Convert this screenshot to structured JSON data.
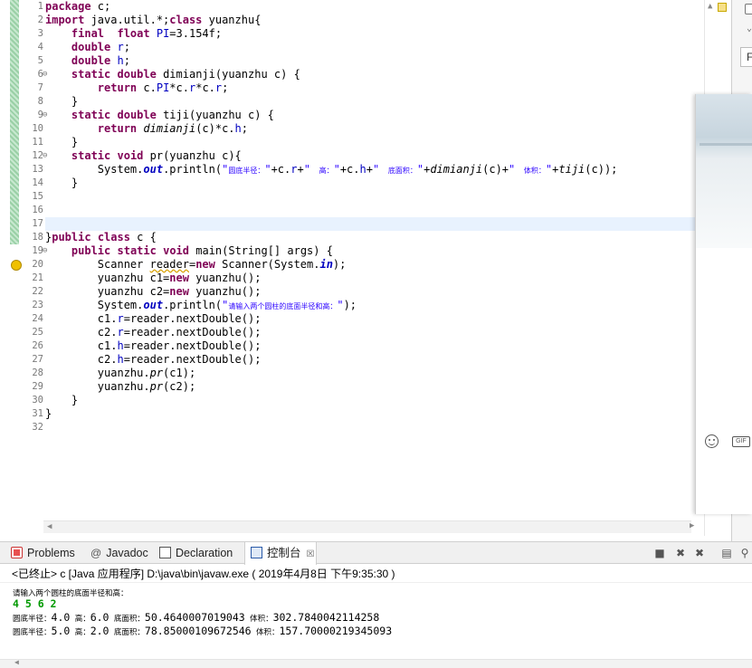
{
  "editor": {
    "line_numbers": [
      "1",
      "2",
      "3",
      "4",
      "5",
      "6",
      "7",
      "8",
      "9",
      "10",
      "11",
      "12",
      "13",
      "14",
      "15",
      "16",
      "17",
      "18",
      "19",
      "20",
      "21",
      "22",
      "23",
      "24",
      "25",
      "26",
      "27",
      "28",
      "29",
      "30",
      "31",
      "32"
    ],
    "folds": {
      "line6": "⊖",
      "line9": "⊖",
      "line12": "⊖",
      "line19": "⊖"
    },
    "code": {
      "l1_kw": "package",
      "l1_rest": " c;",
      "l2_kw1": "import",
      "l2_mid": " java.util.*;",
      "l2_kw2": "class",
      "l2_rest": " yuanzhu{",
      "l3_kw": "final",
      "l3_kw2": "float",
      "l3_fld": "PI",
      "l3_rest": "=3.154f;",
      "l4_kw": "double",
      "l4_fld": "r",
      "l4_rest": ";",
      "l5_kw": "double",
      "l5_fld": "h",
      "l5_rest": ";",
      "l6_kw1": "static",
      "l6_kw2": "double",
      "l6_rest": " dimianji(yuanzhu c) {",
      "l7_kw": "return",
      "l7_a": " c.",
      "l7_fld1": "PI",
      "l7_b": "*c.",
      "l7_fld2": "r",
      "l7_c": "*c.",
      "l7_fld3": "r",
      "l7_d": ";",
      "l8": "}",
      "l9_kw1": "static",
      "l9_kw2": "double",
      "l9_rest": " tiji(yuanzhu c) {",
      "l10_kw": "return",
      "l10_it": "dimianji",
      "l10_a": "(c)*c.",
      "l10_fld": "h",
      "l10_b": ";",
      "l11": "}",
      "l12_kw1": "static",
      "l12_kw2": "void",
      "l12_rest": " pr(yuanzhu c){",
      "l13_a": "System.",
      "l13_sf": "out",
      "l13_b": ".println(",
      "l13_s1q": "\"",
      "l13_s1m": "圆底半径：",
      "l13_s1e": "\"",
      "l13_c": "+c.",
      "l13_fld1": "r",
      "l13_d": "+",
      "l13_s2q": "\"",
      "l13_s2m": "  高：",
      "l13_s2e": "\"",
      "l13_e": "+c.",
      "l13_fld2": "h",
      "l13_f": "+",
      "l13_s3q": "\"",
      "l13_s3m": "  底面积：",
      "l13_s3e": "\"",
      "l13_g": "+",
      "l13_it1": "dimianji",
      "l13_h": "(c)+",
      "l13_s4q": "\"",
      "l13_s4m": "  体积：",
      "l13_s4e": "\"",
      "l13_i": "+",
      "l13_it2": "tiji",
      "l13_j": "(c));",
      "l14": "}",
      "l18_a": "}",
      "l18_kw1": "public",
      "l18_kw2": "class",
      "l18_rest": " c {",
      "l19_kw1": "public",
      "l19_kw2": "static",
      "l19_kw3": "void",
      "l19_rest": " main(String[] args) {",
      "l20_a": "Scanner ",
      "l20_sq": "reader",
      "l20_b": "=",
      "l20_kw": "new",
      "l20_c": " Scanner(System.",
      "l20_sf": "in",
      "l20_d": ");",
      "l21_a": "yuanzhu c1=",
      "l21_kw": "new",
      "l21_b": " yuanzhu();",
      "l22_a": "yuanzhu c2=",
      "l22_kw": "new",
      "l22_b": " yuanzhu();",
      "l23_a": "System.",
      "l23_sf": "out",
      "l23_b": ".println(",
      "l23_sq": "\"",
      "l23_sm": "请输入两个圆柱的底面半径和高：",
      "l23_se": "\"",
      "l23_c": ");",
      "l24_a": "c1.",
      "l24_fld": "r",
      "l24_b": "=reader.nextDouble();",
      "l25_a": "c2.",
      "l25_fld": "r",
      "l25_b": "=reader.nextDouble();",
      "l26_a": "c1.",
      "l26_fld": "h",
      "l26_b": "=reader.nextDouble();",
      "l27_a": "c2.",
      "l27_fld": "h",
      "l27_b": "=reader.nextDouble();",
      "l28_a": "yuanzhu.",
      "l28_it": "pr",
      "l28_b": "(c1);",
      "l29_a": "yuanzhu.",
      "l29_it": "pr",
      "l29_b": "(c2);",
      "l30": "}",
      "l31": "}"
    }
  },
  "right_panel": {
    "field_text": "F"
  },
  "views": {
    "problems": "Problems",
    "javadoc_icon": "@",
    "javadoc": "Javadoc",
    "declaration": "Declaration",
    "console": "控制台",
    "console_close": "☒"
  },
  "toolbar": {
    "icons": [
      "terminate-icon",
      "remove-launch-icon",
      "remove-all-icon",
      "scroll-lock-icon",
      "pin-icon"
    ]
  },
  "console": {
    "status": "<已终止> c [Java 应用程序] D:\\java\\bin\\javaw.exe ( 2019年4月8日 下午9:35:30 )",
    "prompt": "请输入两个圆柱的底面半径和高：",
    "input": "4 5 6 2",
    "r1_l1": "圆底半径：",
    "r1_v1": "4.0",
    "r1_l2": "  高：",
    "r1_v2": "6.0",
    "r1_l3": "  底面积：",
    "r1_v3": "50.4640007019043",
    "r1_l4": "  体积：",
    "r1_v4": "302.7840042114258",
    "r2_l1": "圆底半径：",
    "r2_v1": "5.0",
    "r2_l2": "  高：",
    "r2_v2": "2.0",
    "r2_l3": "  底面积：",
    "r2_v3": "78.85000109672546",
    "r2_l4": "  体积：",
    "r2_v4": "157.70000219345093"
  },
  "overlay": {
    "gif_label": "GIF"
  },
  "colors": {
    "keyword": "#7f0055",
    "field": "#0000c0",
    "string": "#2a00ff",
    "current_line": "#e8f2fe",
    "stdin": "#009900"
  }
}
